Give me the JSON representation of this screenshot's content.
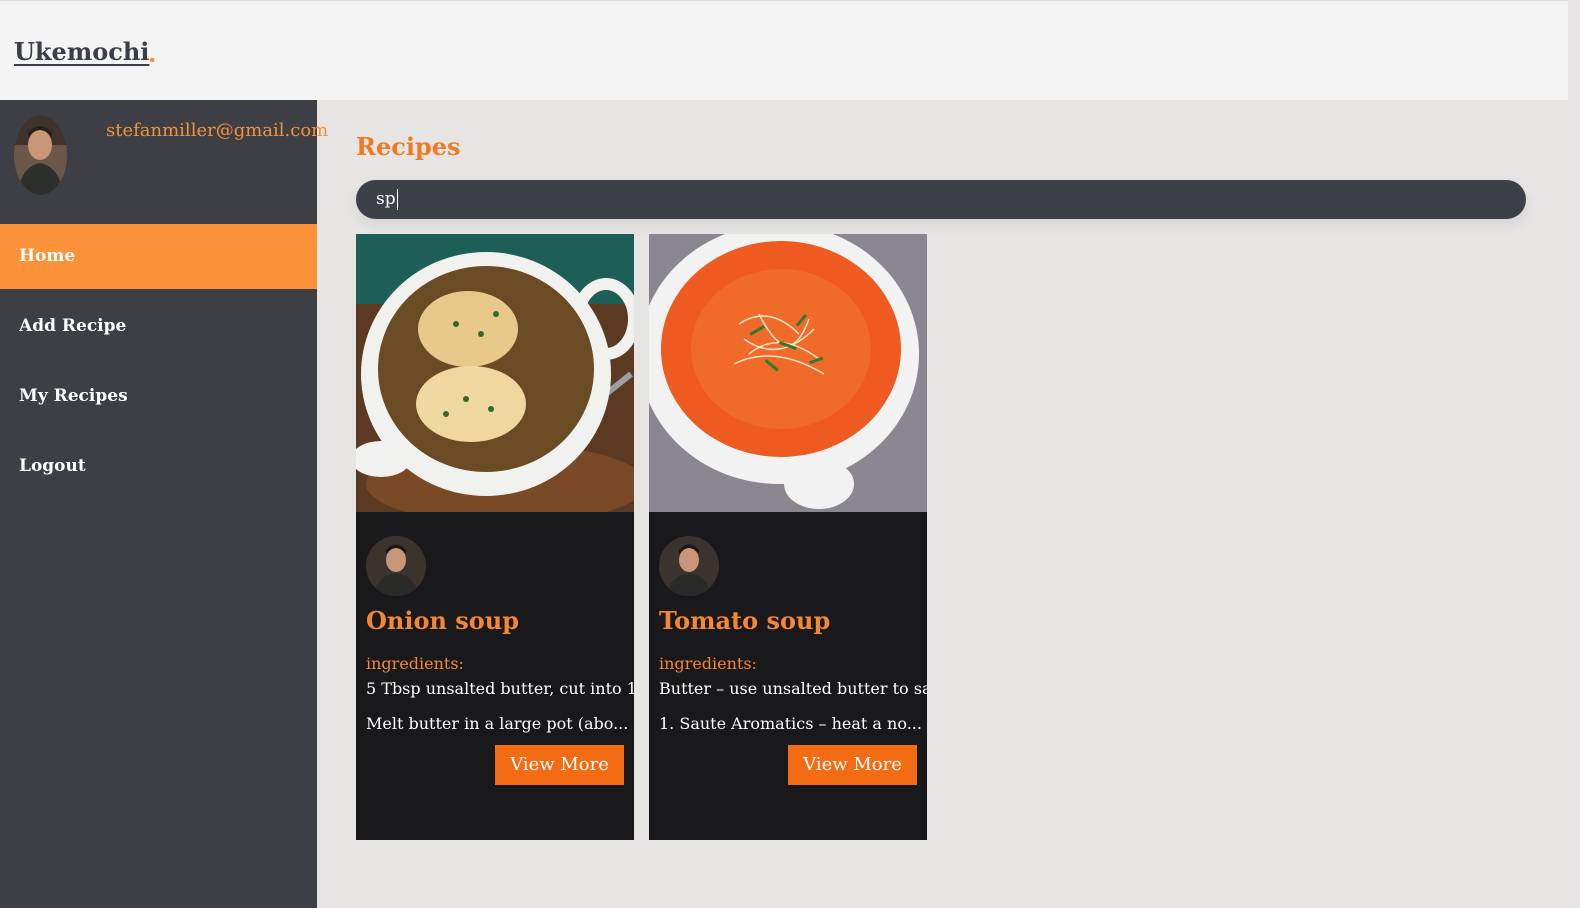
{
  "header": {
    "brand": "Ukemochi",
    "brand_dot": "."
  },
  "sidebar": {
    "email": "stefanmiller@gmail.com",
    "avatar": "user-avatar",
    "nav": [
      {
        "label": "Home",
        "active": true
      },
      {
        "label": "Add Recipe",
        "active": false
      },
      {
        "label": "My Recipes",
        "active": false
      },
      {
        "label": "Logout",
        "active": false
      }
    ]
  },
  "main": {
    "title": "Recipes",
    "search": {
      "value": "sp"
    },
    "cards": [
      {
        "title": "Onion soup",
        "ingredients_label": "ingredients:",
        "ingredients": "5 Tbsp unsalted butter, cut into 1-",
        "description": "Melt butter in a large pot (abo...",
        "button": "View More",
        "image": "onion-soup-photo"
      },
      {
        "title": "Tomato soup",
        "ingredients_label": "ingredients:",
        "ingredients": "Butter – use unsalted butter to sa",
        "description": "1. Saute Aromatics – heat a no...",
        "button": "View More",
        "image": "tomato-soup-photo"
      }
    ]
  },
  "colors": {
    "accent": "#f58634",
    "nav_active": "#fb9139",
    "sidebar_bg": "#3d3f45",
    "card_bg": "#19191b",
    "button_bg": "#f36b12"
  }
}
